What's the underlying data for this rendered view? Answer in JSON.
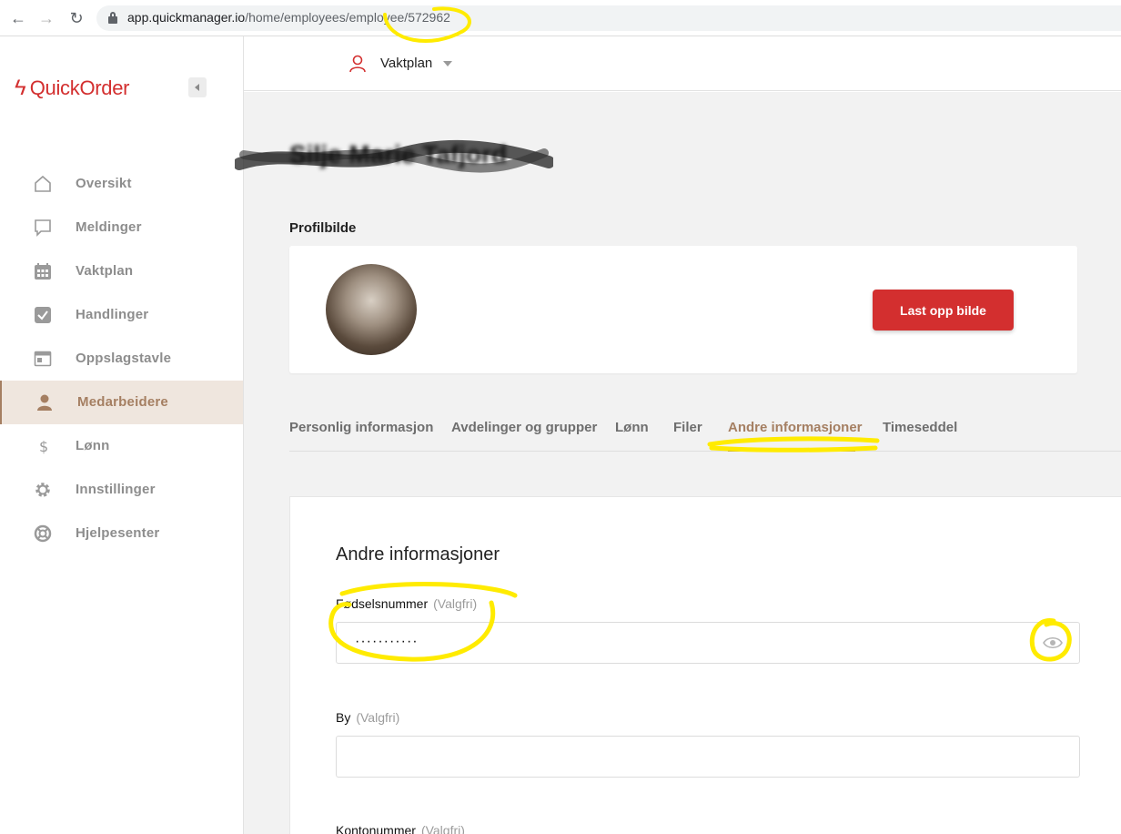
{
  "browser": {
    "url_host": "app.quickmanager.io",
    "url_path": "/home/employees/employee/572962"
  },
  "sidebar": {
    "logo": "QuickOrder",
    "items": [
      {
        "label": "Oversikt",
        "icon": "home-icon",
        "active": false
      },
      {
        "label": "Meldinger",
        "icon": "chat-icon",
        "active": false
      },
      {
        "label": "Vaktplan",
        "icon": "calendar-icon",
        "active": false
      },
      {
        "label": "Handlinger",
        "icon": "checkbox-icon",
        "active": false
      },
      {
        "label": "Oppslagstavle",
        "icon": "board-icon",
        "active": false
      },
      {
        "label": "Medarbeidere",
        "icon": "person-icon",
        "active": true
      },
      {
        "label": "Lønn",
        "icon": "dollar-icon",
        "active": false
      },
      {
        "label": "Innstillinger",
        "icon": "gear-icon",
        "active": false
      },
      {
        "label": "Hjelpesenter",
        "icon": "lifebuoy-icon",
        "active": false
      }
    ]
  },
  "topbar": {
    "dropdown_label": "Vaktplan"
  },
  "employee": {
    "name": "Silje Marie Tafjord"
  },
  "profile": {
    "section_title": "Profilbilde",
    "upload_label": "Last opp bilde"
  },
  "tabs": [
    {
      "label": "Personlig informasjon",
      "active": false
    },
    {
      "label": "Avdelinger og grupper",
      "active": false
    },
    {
      "label": "Lønn",
      "active": false
    },
    {
      "label": "Filer",
      "active": false
    },
    {
      "label": "Andre informasjoner",
      "active": true
    },
    {
      "label": "Timeseddel",
      "active": false
    }
  ],
  "form": {
    "heading": "Andre informasjoner",
    "optional_tag": "(Valgfri)",
    "fields": [
      {
        "label": "Fødselsnummer",
        "value": "···········"
      },
      {
        "label": "By",
        "value": ""
      },
      {
        "label": "Kontonummer",
        "value": ""
      }
    ]
  },
  "colors": {
    "brand": "#d32f2f",
    "accent": "#a57f62",
    "highlight": "#ffeb00"
  }
}
